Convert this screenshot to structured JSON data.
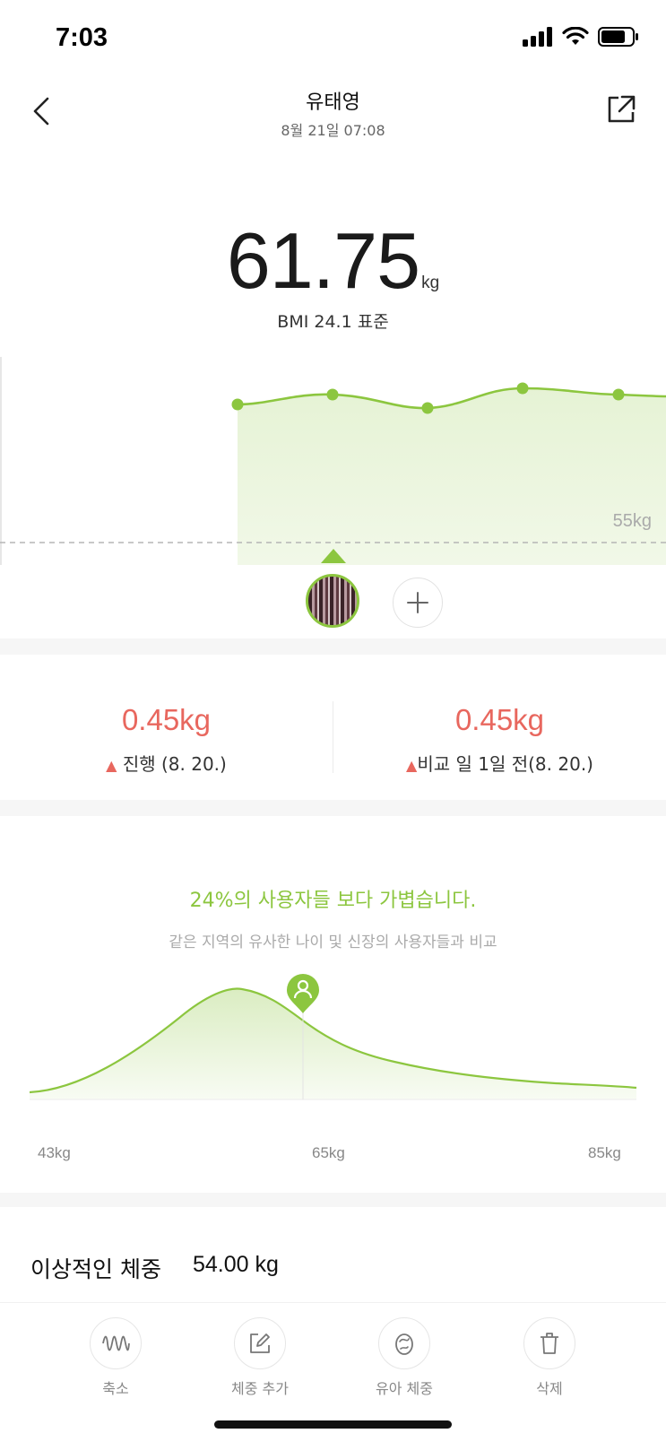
{
  "status": {
    "time": "7:03"
  },
  "nav": {
    "title": "유태영",
    "subtitle": "8월 21일 07:08"
  },
  "weight": {
    "value": "61.75",
    "unit": "kg",
    "bmi_text": "BMI 24.1 표준"
  },
  "trend": {
    "reference_label": "55kg"
  },
  "compare": {
    "left": {
      "value": "0.45kg",
      "label": "진행 (8. 20.)"
    },
    "right": {
      "value": "0.45kg",
      "label": "비교 일 1일 전(8. 20.)"
    }
  },
  "distribution": {
    "headline": "24%의 사용자들 보다 가볍습니다.",
    "subtitle": "같은 지역의 유사한 나이 및 신장의 사용자들과 비교",
    "ticks": [
      "43kg",
      "65kg",
      "85kg"
    ]
  },
  "ideal": {
    "label": "이상적인 체중",
    "value": "54.00 kg"
  },
  "toolbar": {
    "items": [
      {
        "label": "축소",
        "icon": "wave-icon"
      },
      {
        "label": "체중 추가",
        "icon": "edit-icon"
      },
      {
        "label": "유아 체중",
        "icon": "baby-icon"
      },
      {
        "label": "삭제",
        "icon": "trash-icon"
      }
    ]
  },
  "colors": {
    "accent": "#8cc63f",
    "increase": "#e8675e"
  }
}
